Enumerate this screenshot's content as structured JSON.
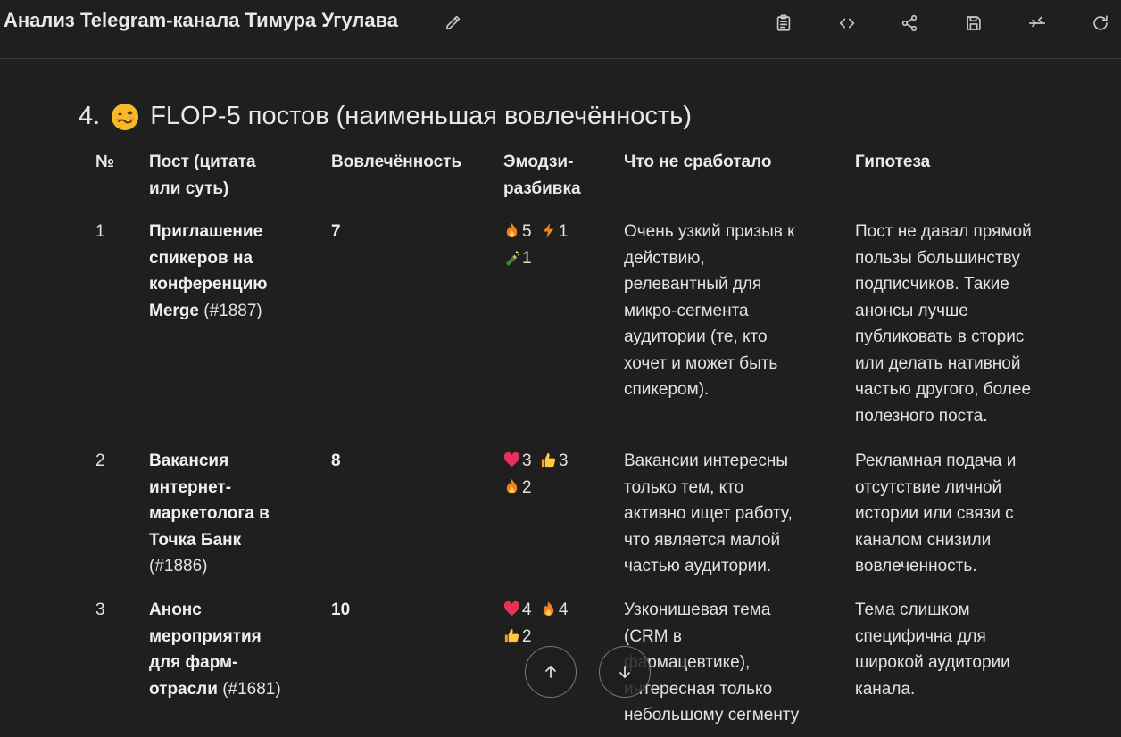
{
  "header": {
    "title": "Анализ Telegram-канала Тимура Угулава",
    "icons": [
      "edit-icon",
      "clipboard-icon",
      "code-icon",
      "share-icon",
      "save-icon",
      "collapse-icon",
      "refresh-icon"
    ]
  },
  "section": {
    "number": "4.",
    "title": "FLOP-5 постов (наименьшая вовлечённость)",
    "emoji": "woozy-face-emoji"
  },
  "table": {
    "headers": {
      "num": "№",
      "post_1": "Пост (цитата",
      "post_2": "или суть)",
      "engagement": "Вовлечённость",
      "emoji_1": "Эмодзи-",
      "emoji_2": "разбивка",
      "failed": "Что не сработало",
      "hypothesis": "Гипотеза"
    },
    "rows": [
      {
        "num": "1",
        "post_lines": [
          "Приглашение",
          "спикеров на",
          "конференцию"
        ],
        "post_last_bold": "Merge",
        "post_ref": " (#1887)",
        "engagement": "7",
        "emojis": [
          {
            "icon": "fire-emoji",
            "count": "5"
          },
          {
            "icon": "lightning-emoji",
            "count": "1"
          },
          {
            "icon": "champagne-emoji",
            "count": "1"
          }
        ],
        "failed": [
          "Очень узкий призыв к",
          "действию,",
          "релевантный для",
          "микро-сегмента",
          "аудитории (те, кто",
          "хочет и может быть",
          "спикером)."
        ],
        "hypothesis": [
          "Пост не давал прямой",
          "пользы большинству",
          "подписчиков. Такие",
          "анонсы лучше",
          "публиковать в сторис",
          "или делать нативной",
          "частью другого, более",
          "полезного поста."
        ]
      },
      {
        "num": "2",
        "post_lines": [
          "Вакансия",
          "интернет-",
          "маркетолога в",
          "Точка Банк"
        ],
        "post_ref": "(#1886)",
        "engagement": "8",
        "emojis": [
          {
            "icon": "heart-emoji",
            "count": "3"
          },
          {
            "icon": "thumbs-up-emoji",
            "count": "3"
          },
          {
            "icon": "fire-emoji",
            "count": "2"
          }
        ],
        "failed": [
          "Вакансии интересны",
          "только тем, кто",
          "активно ищет работу,",
          "что является малой",
          "частью аудитории."
        ],
        "hypothesis": [
          "Рекламная подача и",
          "отсутствие личной",
          "истории или связи с",
          "каналом снизили",
          "вовлеченность."
        ]
      },
      {
        "num": "3",
        "post_lines": [
          "Анонс",
          "мероприятия",
          "для фарм-"
        ],
        "post_last_bold": "отрасли",
        "post_ref": " (#1681)",
        "engagement": "10",
        "emojis": [
          {
            "icon": "heart-emoji",
            "count": "4"
          },
          {
            "icon": "fire-emoji",
            "count": "4"
          },
          {
            "icon": "thumbs-up-emoji",
            "count": "2"
          }
        ],
        "failed": [
          "Узконишевая тема",
          "(CRM в",
          "фармацевтике),",
          "интересная только",
          "небольшому сегменту"
        ],
        "hypothesis": [
          "Тема слишком",
          "специфична для",
          "широкой аудитории",
          "канала."
        ]
      }
    ]
  },
  "scroll": {
    "up_icon": "arrow-up-icon",
    "down_icon": "arrow-down-icon"
  }
}
